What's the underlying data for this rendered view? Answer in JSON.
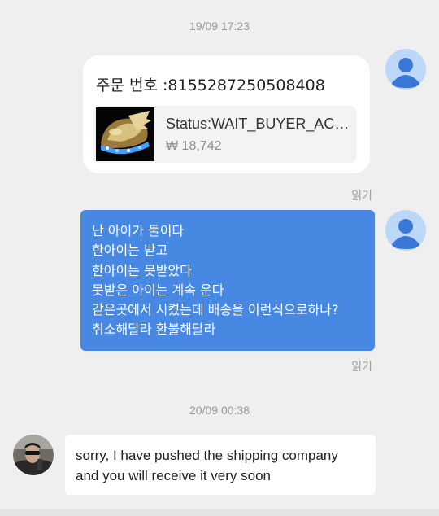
{
  "chat": {
    "timestamps": [
      "19/09 17:23",
      "20/09 00:38"
    ],
    "order_message": {
      "title": "주문 번호 :8155287250508408",
      "product": {
        "status": "Status:WAIT_BUYER_AC…",
        "price": "₩ 18,742"
      }
    },
    "read_label": "읽기",
    "user_message": {
      "lines": [
        "난 아이가 둘이다",
        "한아이는 받고",
        "한아이는 못받았다",
        "못받은 아이는 계속 운다",
        "같은곳에서 시켰는데 배송을 이런식으로하나?",
        "취소해달라 환불해달라"
      ]
    },
    "seller_reply": {
      "lines": [
        "sorry, I have pushed the shipping company",
        "and you will receive it very soon"
      ]
    }
  },
  "colors": {
    "background": "#efefef",
    "user_bubble": "#4789e2",
    "avatar_default": "#bdd7f8",
    "avatar_figure": "#3a78d8"
  }
}
